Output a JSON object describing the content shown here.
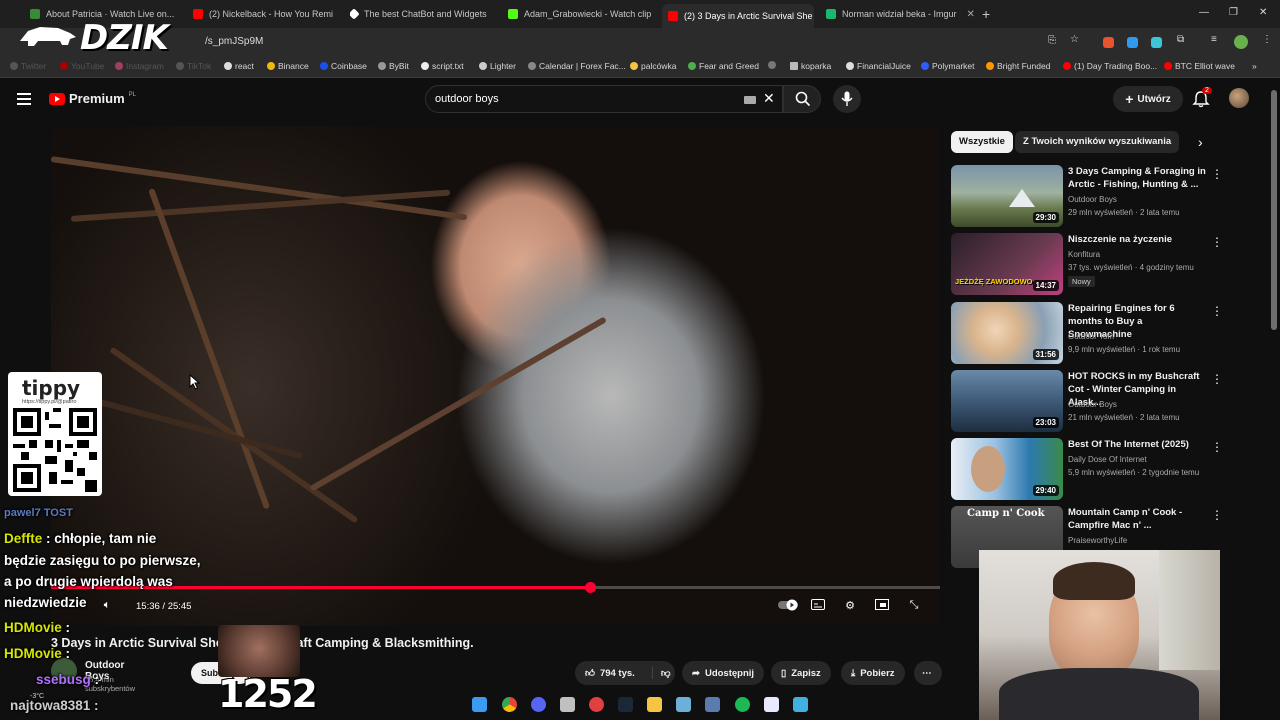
{
  "browser": {
    "tabs": [
      {
        "label": "About Patricia · Watch Live on...",
        "color": "#3a8a3a"
      },
      {
        "label": "(2) Nickelback - How You Remi",
        "color": "#ff0000"
      },
      {
        "label": "The best ChatBot and Widgets",
        "color": "#ffffff"
      },
      {
        "label": "Adam_Grabowiecki - Watch clip",
        "color": "#53fc18"
      },
      {
        "label": "(2) 3 Days in Arctic Survival She",
        "color": "#ff0000"
      },
      {
        "label": "Norman widział beka - Imgur",
        "color": "#1bb76e"
      }
    ],
    "new_tab": "+",
    "url": "/s_pmJSp9M",
    "bookmarks": [
      {
        "label": "Twitter"
      },
      {
        "label": "YouTube"
      },
      {
        "label": "Instagram"
      },
      {
        "label": "TikTok"
      },
      {
        "label": "react"
      },
      {
        "label": "Binance"
      },
      {
        "label": "Coinbase"
      },
      {
        "label": "ByBit"
      },
      {
        "label": "script.txt"
      },
      {
        "label": "Lighter"
      },
      {
        "label": "Calendar | Forex Fac..."
      },
      {
        "label": "palcówka"
      },
      {
        "label": "Fear and Greed"
      },
      {
        "label": ""
      },
      {
        "label": "koparka"
      },
      {
        "label": "FinancialJuice"
      },
      {
        "label": "Polymarket"
      },
      {
        "label": "Bright Funded"
      },
      {
        "label": "(1) Day Trading Boo..."
      },
      {
        "label": "BTC Elliot wave"
      }
    ]
  },
  "overlay": {
    "brand": "DZIK",
    "tippy_logo": "tippy",
    "tippy_url": "https://tippy.pl/@patiro",
    "counter": "1252",
    "chat": [
      {
        "nick": "pawel7 TOST",
        "text": ""
      },
      {
        "nick": "Deffte",
        "text": " : chłopie, tam nie"
      },
      {
        "nick": "",
        "text": "będzie zasięgu to po pierwsze,"
      },
      {
        "nick": "",
        "text": "a po drugie wpierdolą was"
      },
      {
        "nick": "",
        "text": "niedzwiedzie"
      },
      {
        "nick": "HDMovie",
        "text": " :"
      },
      {
        "nick": "HDMovie",
        "text": " :"
      },
      {
        "nick": "ssebusg",
        "text": " :"
      },
      {
        "nick": "",
        "text": "najtowa8381 :"
      }
    ],
    "weather": "-3°C"
  },
  "youtube": {
    "logo": "Premium",
    "logo_suffix": "PL",
    "search_value": "outdoor boys",
    "create_label": "Utwórz",
    "notif_count": "2",
    "player": {
      "time": "15:36 / 25:45",
      "progress": 0.606
    },
    "video_title": "3 Days in Arctic Survival Shelter - Bushcraft Camping & Blacksmithing.",
    "channel": "Outdoor Boys",
    "subs": "15,4 mln subskrybentów",
    "subscribe": "Subskrybuj",
    "actions": {
      "likes": "794 tys.",
      "share": "Udostępnij",
      "save": "Zapisz",
      "download": "Pobierz"
    },
    "chips": [
      "Wszystkie",
      "Z Twoich wyników wyszukiwania"
    ],
    "recommendations": [
      {
        "title": "3 Days Camping & Foraging in Arctic - Fishing, Hunting & ...",
        "channel": "Outdoor Boys",
        "meta": "29 mln wyświetleń · 2 lata temu",
        "duration": "29:30",
        "badge": ""
      },
      {
        "title": "Niszczenie na życzenie",
        "channel": "Konfitura",
        "meta": "37 tys. wyświetleń · 4 godziny temu",
        "duration": "14:37",
        "badge": "Nowy"
      },
      {
        "title": "Repairing Engines for 6 months to Buy a Snowmachine",
        "channel": "Outdoor Tom",
        "meta": "9,9 mln wyświetleń · 1 rok temu",
        "duration": "31:56",
        "badge": ""
      },
      {
        "title": "HOT ROCKS in my Bushcraft Cot - Winter Camping in Alask...",
        "channel": "Outdoor Boys",
        "meta": "21 mln wyświetleń · 2 lata temu",
        "duration": "23:03",
        "badge": ""
      },
      {
        "title": "Best Of The Internet (2025)",
        "channel": "Daily Dose Of Internet",
        "meta": "5,9 mln wyświetleń · 2 tygodnie temu",
        "duration": "29:40",
        "badge": ""
      },
      {
        "title": "Mountain Camp n' Cook - Campfire Mac n' ...",
        "channel": "PraiseworthyLife",
        "meta": "",
        "duration": "",
        "badge": "",
        "thumb_text": "Camp n' Cook"
      }
    ],
    "thumb_overlay_2": "JEŻDŻĘ ZAWODOWO"
  }
}
